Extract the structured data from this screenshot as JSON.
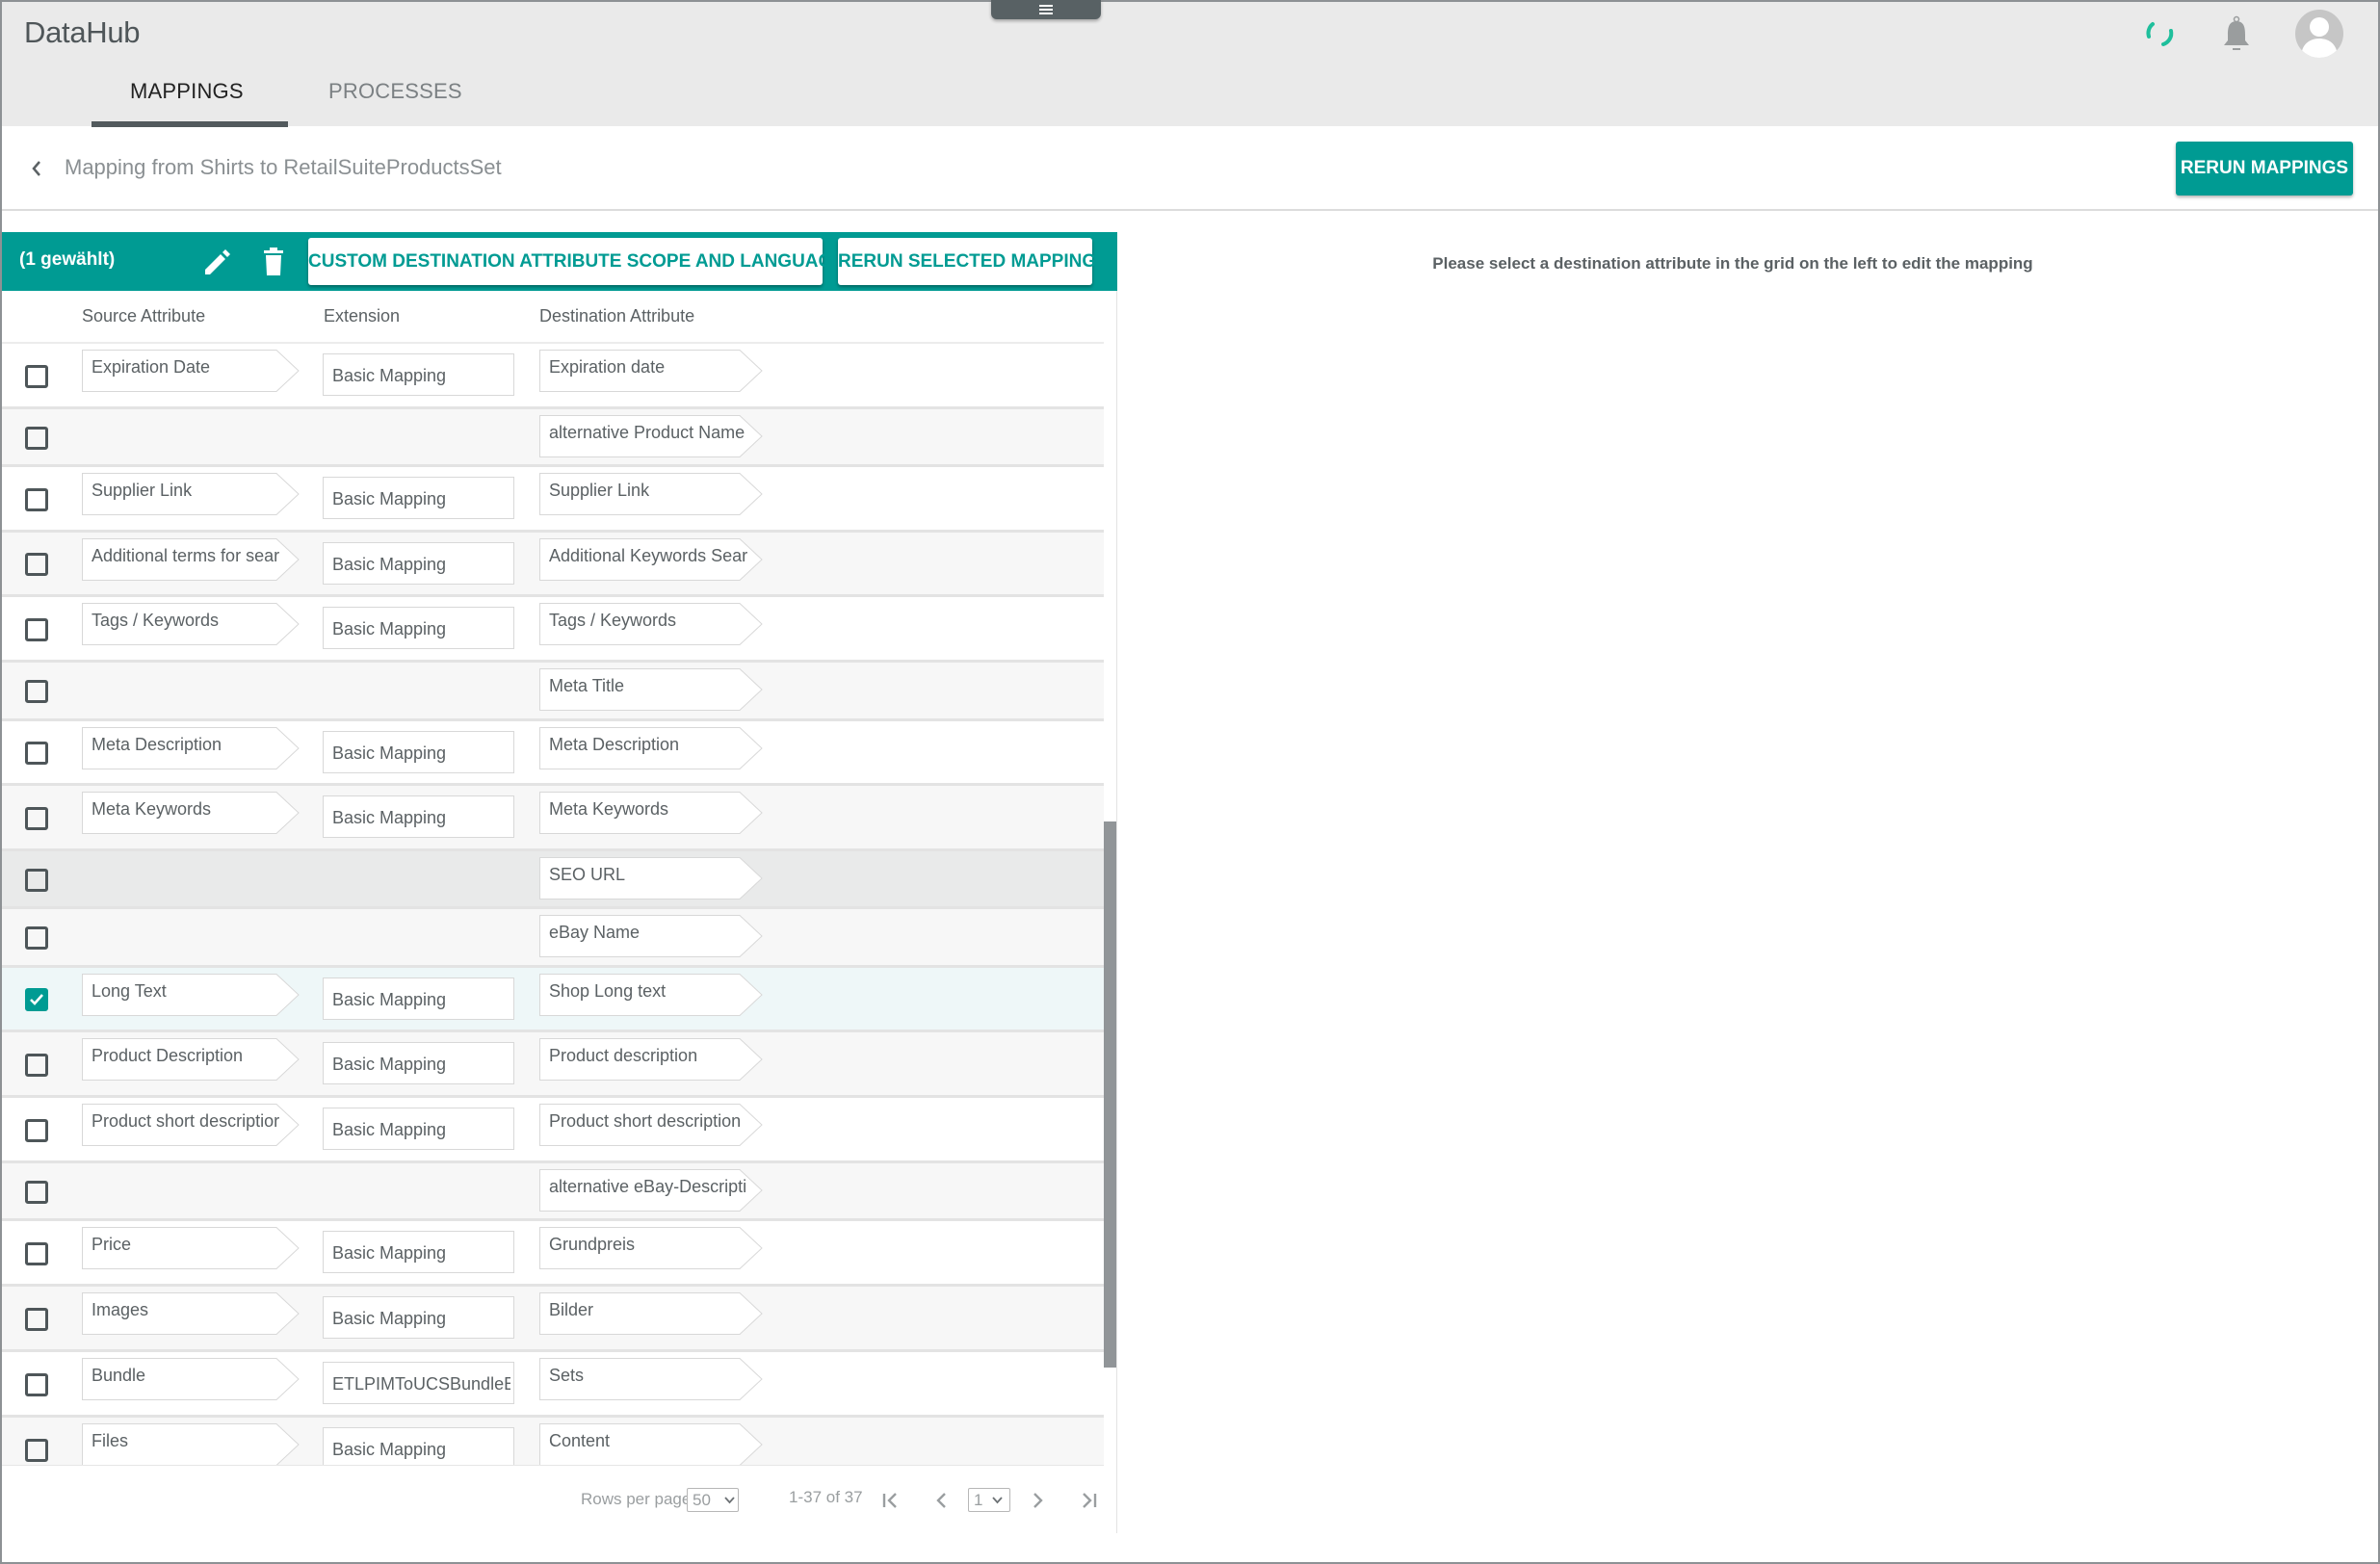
{
  "app": {
    "title": "DataHub",
    "tabs": [
      {
        "label": "MAPPINGS",
        "active": true
      },
      {
        "label": "PROCESSES",
        "active": false
      }
    ],
    "accent_color": "#009b93"
  },
  "header": {
    "breadcrumb": "Mapping from Shirts to RetailSuiteProductsSet",
    "rerun_mappings_label": "RERUN MAPPINGS"
  },
  "toolbar": {
    "selection_count": "(1 gewählt)",
    "custom_scope_label": "CUSTOM DESTINATION ATTRIBUTE SCOPE AND LANGUAGE",
    "rerun_selected_label": "RERUN SELECTED MAPPING"
  },
  "detail_panel": {
    "hint": "Please select a destination attribute in the grid on the left to edit the mapping"
  },
  "table": {
    "columns": [
      "Source Attribute",
      "Extension",
      "Destination Attribute"
    ],
    "rows": [
      {
        "source": "Expiration Date",
        "extension": "Basic Mapping",
        "destination": "Expiration date",
        "checked": false
      },
      {
        "source": "",
        "extension": "",
        "destination": "alternative Product Name",
        "checked": false
      },
      {
        "source": "Supplier Link",
        "extension": "Basic Mapping",
        "destination": "Supplier Link",
        "checked": false
      },
      {
        "source": "Additional terms for sear",
        "extension": "Basic Mapping",
        "destination": "Additional Keywords Sear",
        "checked": false
      },
      {
        "source": "Tags / Keywords",
        "extension": "Basic Mapping",
        "destination": "Tags / Keywords",
        "checked": false
      },
      {
        "source": "",
        "extension": "",
        "destination": "Meta Title",
        "checked": false
      },
      {
        "source": "Meta Description",
        "extension": "Basic Mapping",
        "destination": "Meta Description",
        "checked": false
      },
      {
        "source": "Meta Keywords",
        "extension": "Basic Mapping",
        "destination": "Meta Keywords",
        "checked": false
      },
      {
        "source": "",
        "extension": "",
        "destination": "SEO URL",
        "checked": false
      },
      {
        "source": "",
        "extension": "",
        "destination": "eBay Name",
        "checked": false
      },
      {
        "source": "Long Text",
        "extension": "Basic Mapping",
        "destination": "Shop Long text",
        "checked": true
      },
      {
        "source": "Product Description",
        "extension": "Basic Mapping",
        "destination": "Product description",
        "checked": false
      },
      {
        "source": "Product short descriptior",
        "extension": "Basic Mapping",
        "destination": "Product short description",
        "checked": false
      },
      {
        "source": "",
        "extension": "",
        "destination": "alternative eBay-Descripti",
        "checked": false
      },
      {
        "source": "Price",
        "extension": "Basic Mapping",
        "destination": "Grundpreis",
        "checked": false
      },
      {
        "source": "Images",
        "extension": "Basic Mapping",
        "destination": "Bilder",
        "checked": false
      },
      {
        "source": "Bundle",
        "extension": "ETLPIMToUCSBundleE",
        "destination": "Sets",
        "checked": false
      },
      {
        "source": "Files",
        "extension": "Basic Mapping",
        "destination": "Content",
        "checked": false
      }
    ]
  },
  "pagination": {
    "rows_per_page_label": "Rows per page:",
    "rows_per_page": "50",
    "range": "1-37 of 37",
    "page": "1"
  },
  "icons": {
    "menu_handle": "hamburger-icon",
    "status": "sync-spinner-icon",
    "notifications": "bell-icon",
    "user": "avatar-icon",
    "back": "chevron-left-icon",
    "edit": "pencil-icon",
    "delete": "trash-icon"
  }
}
